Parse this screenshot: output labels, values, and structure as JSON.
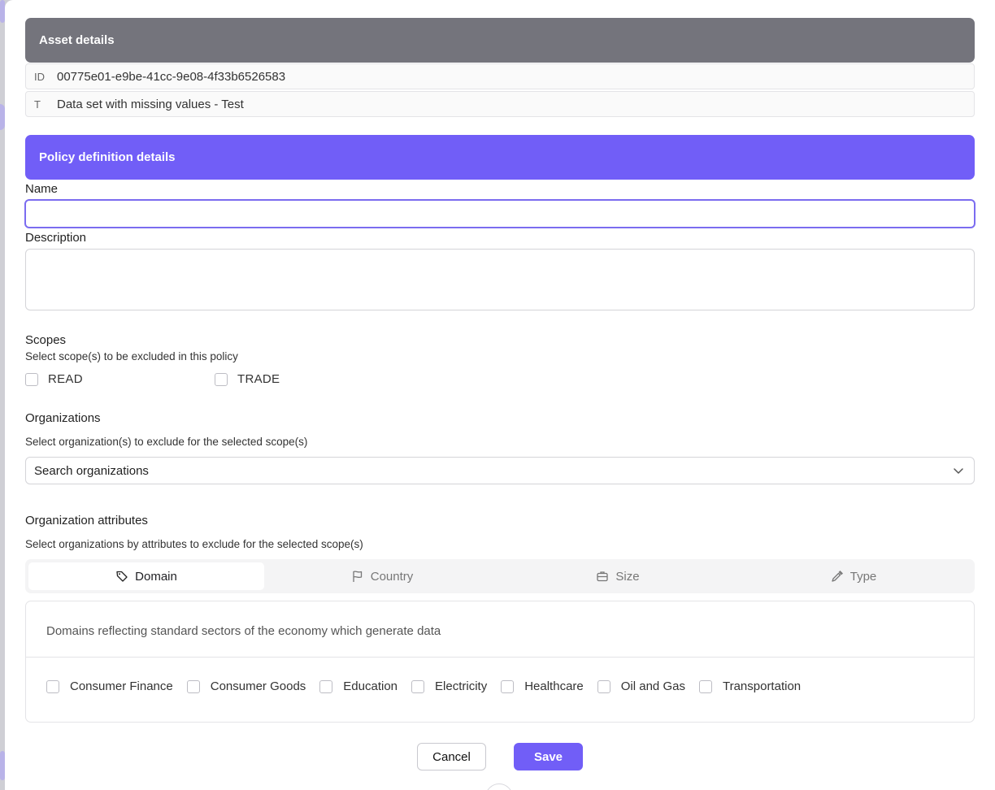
{
  "asset": {
    "header": "Asset details",
    "id_tag": "ID",
    "id_value": "00775e01-e9be-41cc-9e08-4f33b6526583",
    "title_tag": "T",
    "title_value": "Data set with missing values - Test"
  },
  "policy": {
    "header": "Policy definition details",
    "name_label": "Name",
    "name_value": "",
    "description_label": "Description",
    "description_value": ""
  },
  "scopes": {
    "title": "Scopes",
    "hint": "Select scope(s) to be excluded in this policy",
    "options": [
      {
        "label": "READ",
        "checked": false
      },
      {
        "label": "TRADE",
        "checked": false
      }
    ]
  },
  "organizations": {
    "title": "Organizations",
    "hint": "Select organization(s) to exclude for the selected scope(s)",
    "select_value": "Search organizations",
    "chevron_icon": "chevron-down-icon"
  },
  "attributes": {
    "title": "Organization attributes",
    "hint": "Select organizations by attributes to exclude for the selected scope(s)",
    "tabs": [
      {
        "label": "Domain",
        "icon": "tag-icon",
        "active": true
      },
      {
        "label": "Country",
        "icon": "flag-icon",
        "active": false
      },
      {
        "label": "Size",
        "icon": "briefcase-icon",
        "active": false
      },
      {
        "label": "Type",
        "icon": "pipette-icon",
        "active": false
      }
    ],
    "domain_description": "Domains reflecting standard sectors of the economy which generate data",
    "domains": [
      {
        "label": "Consumer Finance",
        "checked": false
      },
      {
        "label": "Consumer Goods",
        "checked": false
      },
      {
        "label": "Education",
        "checked": false
      },
      {
        "label": "Electricity",
        "checked": false
      },
      {
        "label": "Healthcare",
        "checked": false
      },
      {
        "label": "Oil and Gas",
        "checked": false
      },
      {
        "label": "Transportation",
        "checked": false
      }
    ]
  },
  "actions": {
    "cancel_label": "Cancel",
    "save_label": "Save"
  },
  "colors": {
    "accent": "#715ef7",
    "asset_header": "#74747c"
  }
}
